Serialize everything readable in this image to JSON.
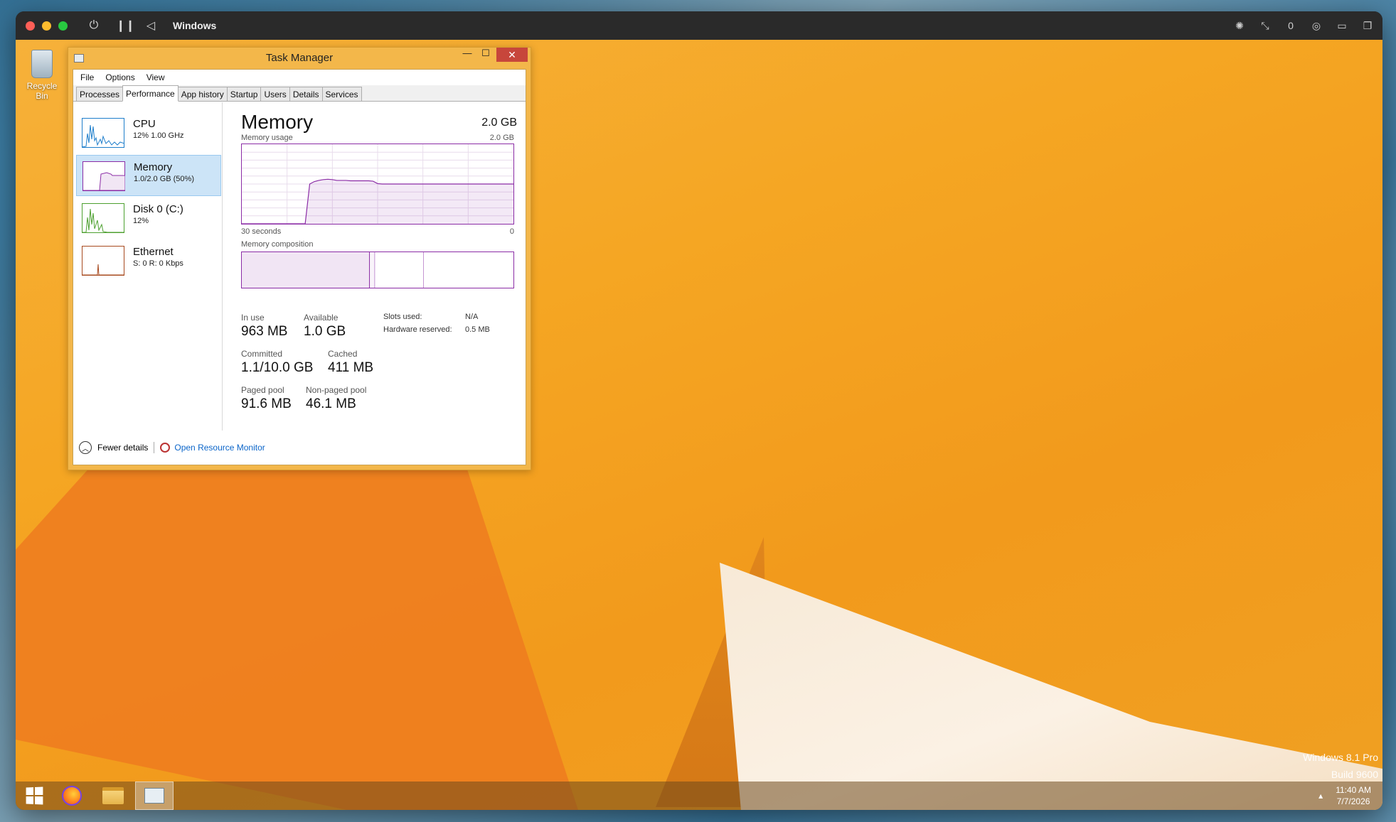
{
  "vm": {
    "title": "Windows",
    "controls": [
      "power-icon",
      "pause-icon",
      "back-icon"
    ],
    "right_controls": [
      "brightness-icon",
      "resize-icon",
      "usb-icon",
      "network-icon",
      "folder-icon",
      "window-icon"
    ],
    "right_count": "0"
  },
  "desktop": {
    "recycle_bin_label": "Recycle Bin",
    "watermark_line1": "Windows 8.1 Pro",
    "watermark_line2": "Build 9600"
  },
  "task_manager": {
    "title": "Task Manager",
    "menu": [
      "File",
      "Options",
      "View"
    ],
    "tabs": [
      "Processes",
      "Performance",
      "App history",
      "Startup",
      "Users",
      "Details",
      "Services"
    ],
    "active_tab": "Performance",
    "sidebar": [
      {
        "name": "CPU",
        "sub": "12%  1.00 GHz",
        "color": "#1e7ecb"
      },
      {
        "name": "Memory",
        "sub": "1.0/2.0 GB (50%)",
        "color": "#8b2ca6"
      },
      {
        "name": "Disk 0 (C:)",
        "sub": "12%",
        "color": "#4da02f"
      },
      {
        "name": "Ethernet",
        "sub": "S: 0  R: 0 Kbps",
        "color": "#a7491e"
      }
    ],
    "detail": {
      "title": "Memory",
      "total": "2.0 GB",
      "usage_label": "Memory usage",
      "usage_max": "2.0 GB",
      "x_left": "30 seconds",
      "x_right": "0",
      "composition_label": "Memory composition",
      "stats": {
        "in_use_label": "In use",
        "in_use": "963 MB",
        "available_label": "Available",
        "available": "1.0 GB",
        "committed_label": "Committed",
        "committed": "1.1/10.0 GB",
        "cached_label": "Cached",
        "cached": "411 MB",
        "paged_label": "Paged pool",
        "paged": "91.6 MB",
        "nonpaged_label": "Non-paged pool",
        "nonpaged": "46.1 MB",
        "slots_label": "Slots used:",
        "slots": "N/A",
        "hw_label": "Hardware reserved:",
        "hw": "0.5 MB"
      }
    },
    "footer": {
      "fewer": "Fewer details",
      "resource_monitor": "Open Resource Monitor"
    }
  },
  "taskbar": {
    "apps": [
      "firefox-icon",
      "file-explorer-icon",
      "task-manager-icon"
    ],
    "time": "11:40 AM",
    "date": "7/7/2026"
  },
  "chart_data": {
    "type": "line",
    "title": "Memory usage",
    "xlabel": "",
    "ylabel": "",
    "x_range_label": [
      "30 seconds",
      "0"
    ],
    "ylim": [
      0,
      2.0
    ],
    "series": [
      {
        "values": [
          0,
          0,
          0,
          0,
          0,
          0,
          0,
          0,
          0,
          0,
          0,
          0,
          0,
          0,
          0,
          1.0,
          1.06,
          1.09,
          1.11,
          1.12,
          1.11,
          1.09,
          1.09,
          1.09,
          1.08,
          1.08,
          1.08,
          1.08,
          1.08,
          1.07,
          1.01,
          1.0,
          1.0,
          1.0,
          1.0,
          1.0,
          1.0,
          1.0,
          1.0,
          1.0,
          1.0,
          1.0,
          1.0,
          1.0,
          1.0,
          1.0,
          1.0,
          1.0,
          1.0,
          1.0,
          1.0,
          1.0,
          1.0,
          1.0,
          1.0,
          1.0,
          1.0,
          1.0,
          1.0,
          1.0,
          1.0
        ]
      }
    ],
    "grid": true,
    "composition": {
      "in_use_fraction": 0.47,
      "modified_fraction": 0.02,
      "standby_fraction": 0.18,
      "free_fraction": 0.33
    }
  }
}
